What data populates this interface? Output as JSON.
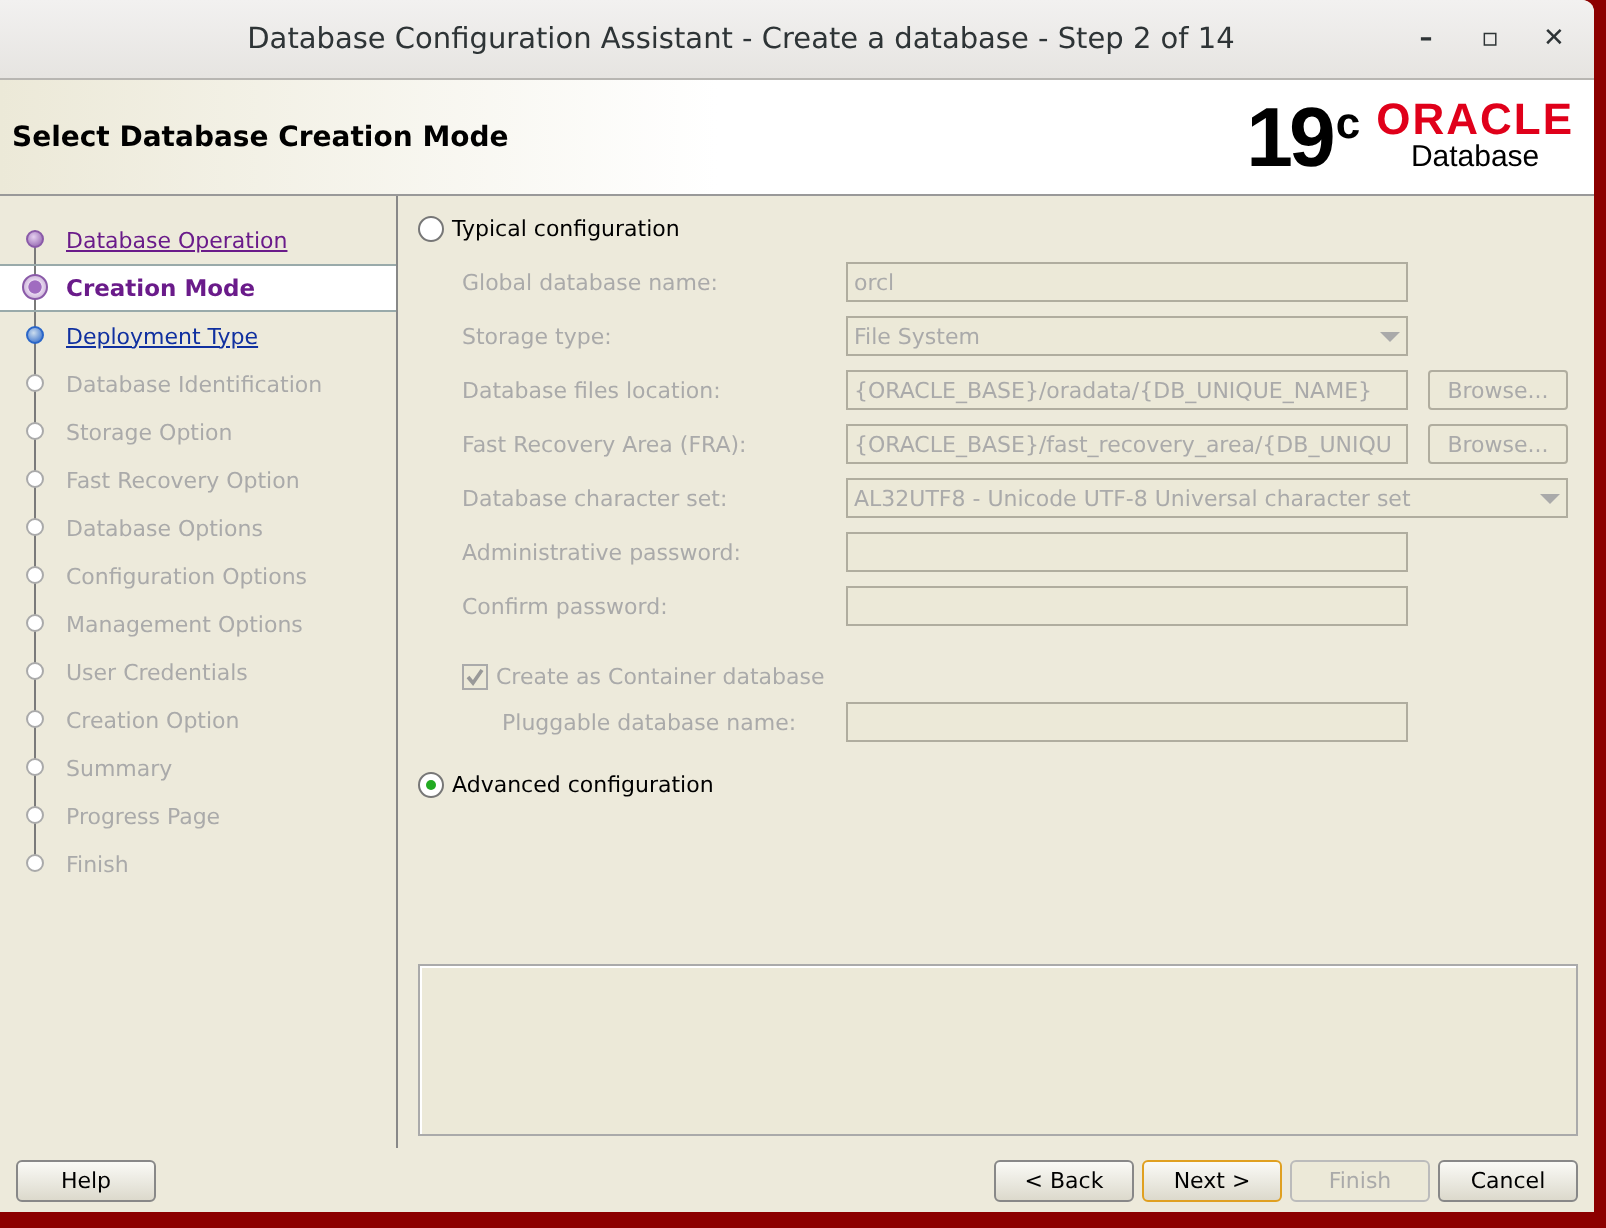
{
  "window": {
    "title": "Database Configuration Assistant - Create a database - Step 2 of 14",
    "controls": [
      "–",
      "▫",
      "✕"
    ]
  },
  "header": {
    "title": "Select Database Creation Mode",
    "logo_version": "19",
    "logo_suffix": "c",
    "logo_brand": "ORACLE",
    "logo_product": "Database"
  },
  "steps": [
    {
      "label": "Database Operation",
      "kind": "visited",
      "selected": false
    },
    {
      "label": "Creation Mode",
      "kind": "visited",
      "selected": true
    },
    {
      "label": "Deployment Type",
      "kind": "next",
      "selected": false
    },
    {
      "label": "Database Identification",
      "kind": "pending",
      "selected": false
    },
    {
      "label": "Storage Option",
      "kind": "pending",
      "selected": false
    },
    {
      "label": "Fast Recovery Option",
      "kind": "pending",
      "selected": false
    },
    {
      "label": "Database Options",
      "kind": "pending",
      "selected": false
    },
    {
      "label": "Configuration Options",
      "kind": "pending",
      "selected": false
    },
    {
      "label": "Management Options",
      "kind": "pending",
      "selected": false
    },
    {
      "label": "User Credentials",
      "kind": "pending",
      "selected": false
    },
    {
      "label": "Creation Option",
      "kind": "pending",
      "selected": false
    },
    {
      "label": "Summary",
      "kind": "pending",
      "selected": false
    },
    {
      "label": "Progress Page",
      "kind": "pending",
      "selected": false
    },
    {
      "label": "Finish",
      "kind": "pending",
      "selected": false
    }
  ],
  "typical": {
    "label": "Typical configuration",
    "selected": false,
    "fields": [
      {
        "kind": "text",
        "label": "Global database name:",
        "value": "orcl"
      },
      {
        "kind": "select",
        "label": "Storage type:",
        "value": "File System"
      },
      {
        "kind": "browse",
        "label": "Database files location:",
        "value": "{ORACLE_BASE}/oradata/{DB_UNIQUE_NAME}",
        "button": "Browse..."
      },
      {
        "kind": "browse",
        "label": "Fast Recovery Area (FRA):",
        "value": "{ORACLE_BASE}/fast_recovery_area/{DB_UNIQU",
        "button": "Browse..."
      },
      {
        "kind": "wide-select",
        "label": "Database character set:",
        "value": "AL32UTF8 - Unicode UTF-8 Universal character set"
      },
      {
        "kind": "text",
        "label": "Administrative password:"
      },
      {
        "kind": "text",
        "label": "Confirm password:"
      }
    ],
    "container": {
      "label": "Create as Container database",
      "checked": true
    },
    "pluggable": {
      "label": "Pluggable database name:"
    }
  },
  "advanced": {
    "label": "Advanced configuration",
    "selected": true
  },
  "buttons": [
    {
      "label": "Help",
      "kind": "left",
      "disabled": false,
      "default": false
    },
    {
      "label": "< Back",
      "kind": "right",
      "disabled": false,
      "default": false
    },
    {
      "label": "Next >",
      "kind": "right",
      "disabled": false,
      "default": true
    },
    {
      "label": "Finish",
      "kind": "right",
      "disabled": true,
      "default": false
    },
    {
      "label": "Cancel",
      "kind": "right",
      "disabled": false,
      "default": false
    }
  ]
}
